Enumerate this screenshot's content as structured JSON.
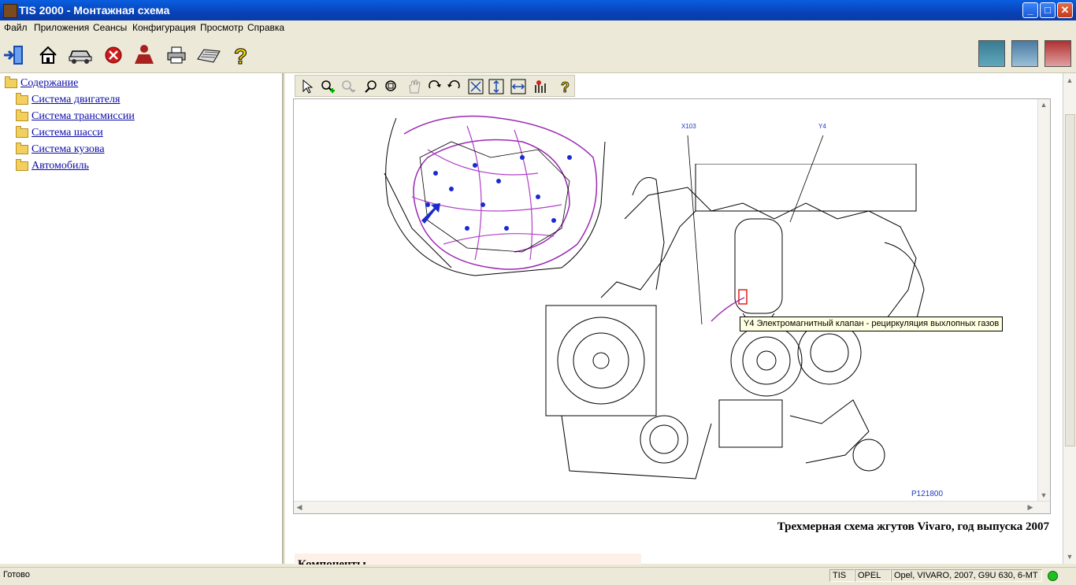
{
  "window": {
    "title": "TIS 2000 - Монтажная схема"
  },
  "menu": [
    {
      "label": "Файл"
    },
    {
      "label": "Приложения"
    },
    {
      "label": "Сеансы"
    },
    {
      "label": "Конфигурация"
    },
    {
      "label": "Просмотр"
    },
    {
      "label": "Справка"
    }
  ],
  "toolbar": {
    "icons": [
      "exit-icon",
      "home-icon",
      "vehicle-icon",
      "stop-icon",
      "user-icon",
      "print-icon",
      "keyboard-icon",
      "help-icon"
    ],
    "right_icons": [
      "diagnostics-app-icon",
      "vehicle-info-app-icon",
      "service-app-icon"
    ]
  },
  "tree": {
    "root": "Содержание",
    "items": [
      {
        "label": "Система двигателя"
      },
      {
        "label": "Система трансмиссии"
      },
      {
        "label": "Система шасси"
      },
      {
        "label": "Система кузова"
      },
      {
        "label": "Автомобиль"
      }
    ]
  },
  "viewer": {
    "tools": [
      "select-tool-icon",
      "zoom-in-icon",
      "zoom-out-icon",
      "zoom-icon",
      "zoom-window-icon",
      "pan-icon",
      "rotate-cw-icon",
      "rotate-ccw-icon",
      "fit-all-icon",
      "fit-height-icon",
      "fit-width-icon",
      "highlight-icon",
      "help-icon"
    ],
    "callout_x103": "X103",
    "callout_y4": "Y4",
    "tooltip": "Y4 Электромагнитный клапан - рециркуляция выхлопных газов",
    "figure_number": "P121800"
  },
  "caption": "Трехмерная схема жгутов Vivaro, год выпуска 2007",
  "section_title": "Компоненты",
  "status": {
    "text": "Готово",
    "field1": "TIS",
    "field2": "OPEL",
    "field3": "Opel, VIVARO, 2007, G9U 630, 6-MT",
    "indicator_color": "#1ec01e"
  },
  "colors": {
    "title_bar": "#0842b8",
    "link": "#0a0aa8",
    "tooltip_bg": "#ffffe1"
  }
}
